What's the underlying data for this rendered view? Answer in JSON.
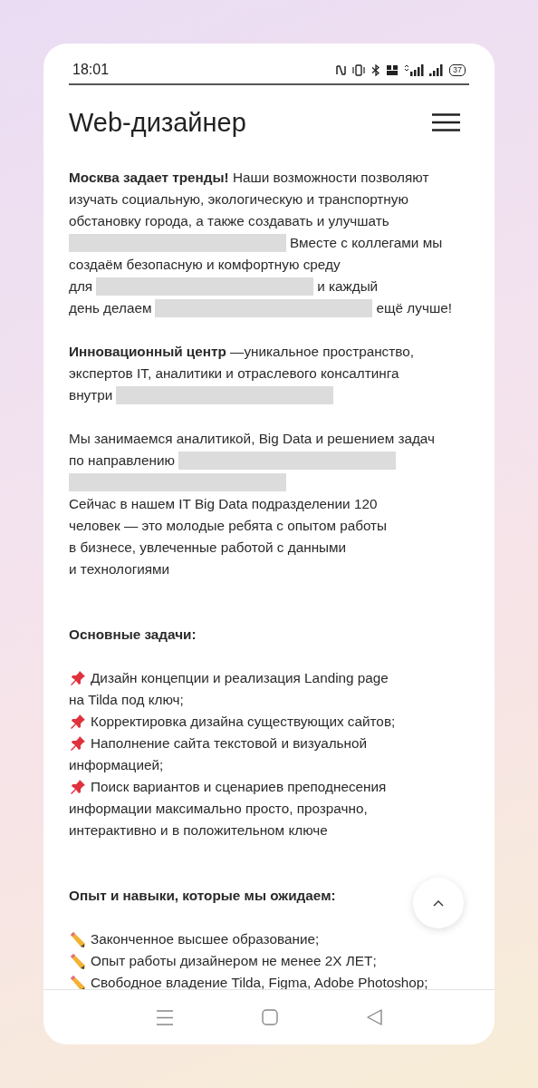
{
  "status_bar": {
    "time": "18:01",
    "battery": "37"
  },
  "header": {
    "title": "Web-дизайнер"
  },
  "blocks": [
    {
      "kind": "paragraph",
      "lines": [
        "**Москва задает тренды!** Наши возможности позволяют",
        "изучать социальную, экологическую и транспортную",
        "обстановку города, а также создавать и улучшать",
        [
          {
            "kind": "redaction"
          },
          {
            "kind": "text",
            "text": "Вместе с коллегами мы"
          }
        ],
        "создаём безопасную и комфортную среду",
        [
          {
            "kind": "text",
            "text": "для"
          },
          {
            "kind": "redaction"
          },
          {
            "kind": "text",
            "text": "и каждый"
          }
        ],
        [
          {
            "kind": "text",
            "text": "день делаем"
          },
          {
            "kind": "redaction"
          },
          {
            "kind": "text",
            "text": "ещё лучше!"
          }
        ]
      ]
    },
    {
      "kind": "paragraph",
      "lines": [
        "**Инновационный центр** —уникальное пространство,",
        "экспертов IT, аналитики и отраслевого консалтинга",
        [
          {
            "kind": "text",
            "text": "внутри"
          },
          {
            "kind": "redaction"
          }
        ]
      ]
    },
    {
      "kind": "paragraph",
      "lines": [
        "Мы занимаемся аналитикой, Big Data и решением задач",
        [
          {
            "kind": "text",
            "text": "по направлению"
          },
          {
            "kind": "redaction"
          }
        ],
        [
          {
            "kind": "redaction"
          }
        ],
        "Сейчас в нашем IT Big Data подразделении 120",
        "человек — это молодые ребята с опытом работы",
        "в бизнесе, увлеченные работой с данными",
        "и технологиями"
      ]
    },
    {
      "kind": "heading",
      "text": "Основные задачи:"
    },
    {
      "kind": "list",
      "items": [
        {
          "kind": "pin",
          "lines": [
            "Дизайн концепции и реализация Landing page",
            "на Tilda под ключ;"
          ]
        },
        {
          "kind": "pin",
          "lines": [
            "Корректировка дизайна существующих сайтов;"
          ]
        },
        {
          "kind": "pin",
          "lines": [
            "Наполнение сайта текстовой и визуальной",
            "информацией;"
          ]
        },
        {
          "kind": "pin",
          "lines": [
            "Поиск вариантов и сценариев преподнесения",
            "информации максимально просто, прозрачно,",
            "интерактивно и в положительном ключе"
          ]
        }
      ]
    },
    {
      "kind": "heading",
      "text": "Опыт и навыки, которые мы ожидаем:"
    },
    {
      "kind": "list",
      "items": [
        {
          "kind": "pencil",
          "lines": [
            "Законченное высшее образование;"
          ]
        },
        {
          "kind": "pencil",
          "lines": [
            "Опыт работы дизайнером не менее 2Х ЛЕТ;"
          ]
        },
        {
          "kind": "pencil",
          "lines": [
            "Свободное владение Tilda, Figma, Adobe Photoshop;"
          ]
        }
      ]
    }
  ]
}
